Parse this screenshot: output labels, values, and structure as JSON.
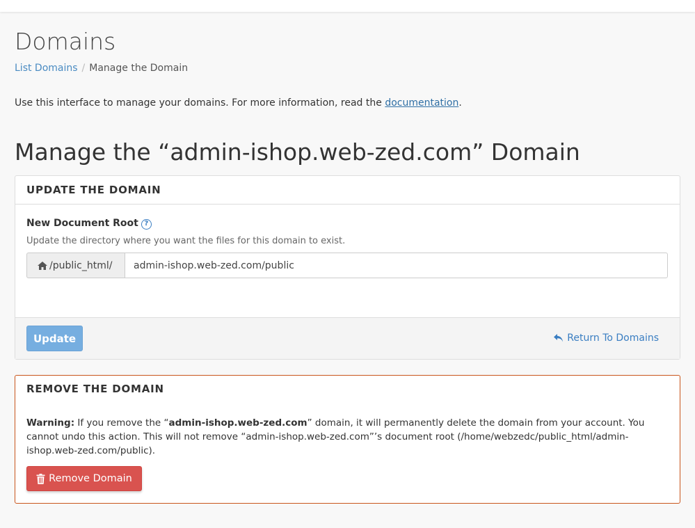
{
  "page": {
    "title": "Domains"
  },
  "breadcrumb": {
    "items": [
      {
        "label": "List Domains",
        "link": true
      },
      {
        "label": "Manage the Domain",
        "link": false
      }
    ],
    "separator": "/"
  },
  "intro": {
    "text": "Use this interface to manage your domains. For more information, read the ",
    "link_label": "documentation",
    "suffix": "."
  },
  "manage": {
    "title": "Manage the “admin-ishop.web-zed.com” Domain"
  },
  "update_panel": {
    "heading": "UPDATE THE DOMAIN",
    "field_label": "New Document Root",
    "help_icon": "question-circle-icon",
    "help_text": "Update the directory where you want the files for this domain to exist.",
    "addon_icon": "home-icon",
    "addon_text": "/public_html/",
    "input_value": "admin-ishop.web-zed.com/public",
    "update_button": "Update",
    "return_icon": "reply-icon",
    "return_link": "Return To Domains"
  },
  "remove_panel": {
    "heading": "REMOVE THE DOMAIN",
    "warning_label": "Warning:",
    "warning_pre": " If you remove the “",
    "warning_domain": "admin-ishop.web-zed.com",
    "warning_post": "” domain, it will permanently delete the domain from your account. You cannot undo this action. This will not remove “admin-ishop.web-zed.com”’s document root (/home/webzedc/public_html/admin-ishop.web-zed.com/public).",
    "remove_icon": "trash-icon",
    "remove_button": "Remove Domain"
  },
  "colors": {
    "link": "#3a7ec2",
    "update_button": "#76aee0",
    "danger": "#d9534f",
    "danger_border": "#c9541a"
  }
}
